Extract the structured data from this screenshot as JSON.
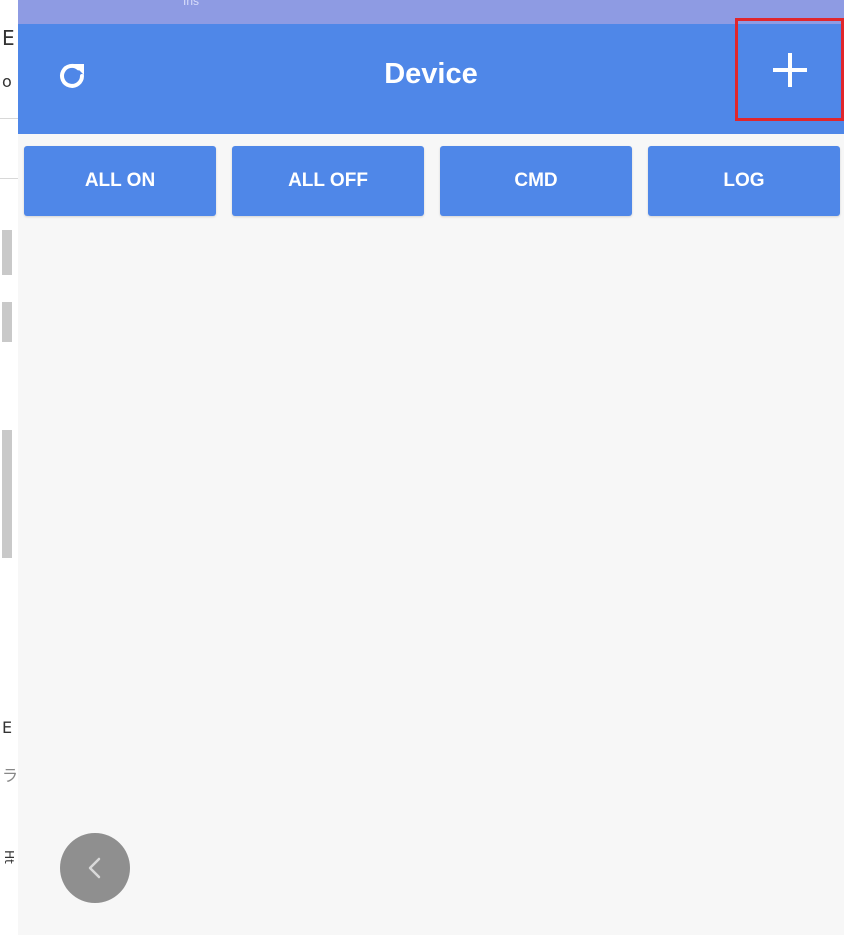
{
  "status": {
    "text": "Ins"
  },
  "appbar": {
    "title": "Device",
    "refresh_icon": "refresh-icon",
    "add_icon": "plus-icon",
    "color": "#4f87e8"
  },
  "buttons": [
    {
      "label": "ALL ON"
    },
    {
      "label": "ALL OFF"
    },
    {
      "label": "CMD"
    },
    {
      "label": "LOG"
    }
  ],
  "back_button": {
    "icon": "chevron-left-icon"
  },
  "colors": {
    "highlight": "#e0262c",
    "fab": "#8f8f8f",
    "background": "#f7f7f7"
  },
  "left_window": {
    "glyphs": [
      "E",
      "o",
      "E",
      "ラ",
      "Ht"
    ]
  }
}
